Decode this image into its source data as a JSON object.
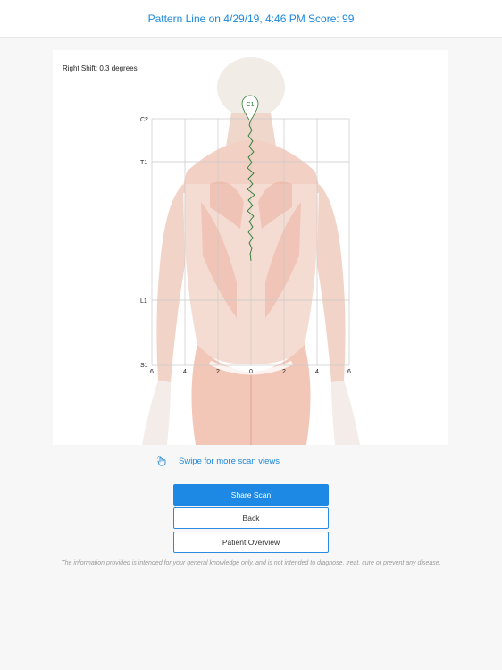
{
  "header": {
    "title": "Pattern Line on 4/29/19, 4:46 PM Score: 99"
  },
  "scan": {
    "shift_label": "Right Shift: 0.3 degrees",
    "marker_label": "C1",
    "vertebra_labels": [
      "C2",
      "T1",
      "L1",
      "S1"
    ],
    "x_ticks": [
      "6",
      "4",
      "2",
      "0",
      "2",
      "4",
      "6"
    ],
    "line_color": "#2e7d32",
    "grid_color": "#c9c9c9"
  },
  "swipe": {
    "icon": "swipe-hand-icon",
    "text": "Swipe for more scan views"
  },
  "buttons": {
    "share": "Share Scan",
    "back": "Back",
    "overview": "Patient Overview"
  },
  "disclaimer": "The information provided is intended for your general knowledge only, and is not intended to diagnose, treat, cure or prevent any disease.",
  "colors": {
    "accent": "#1e88e5",
    "header_text": "#1e88d8"
  }
}
